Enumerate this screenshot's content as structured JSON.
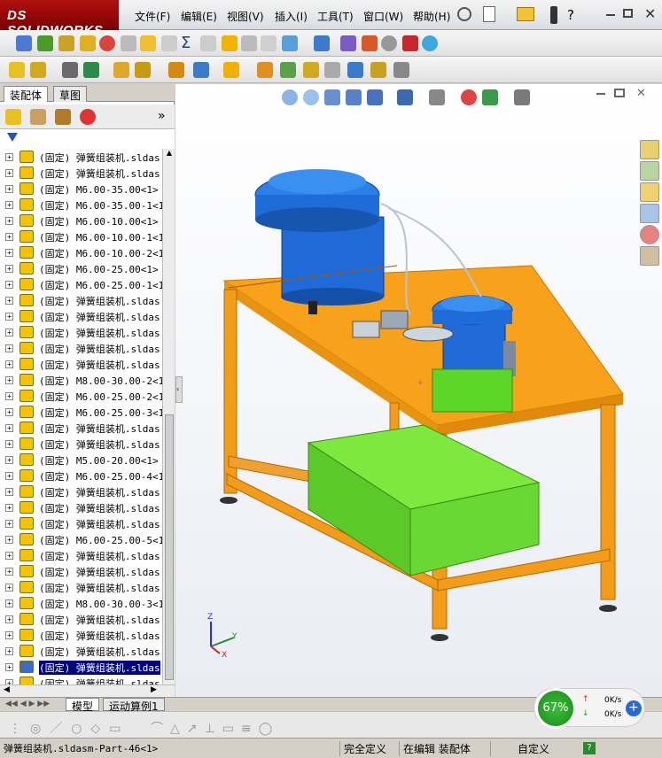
{
  "app": {
    "brand": "SOLIDWORKS",
    "brand_prefix": "DS"
  },
  "menu": [
    "文件(F)",
    "编辑(E)",
    "视图(V)",
    "插入(I)",
    "工具(T)",
    "窗口(W)",
    "帮助(H)"
  ],
  "panel_tabs": [
    "装配体",
    "草图"
  ],
  "tree_items": [
    "(固定) 弹簧组装机.sldas",
    "(固定) 弹簧组装机.sldas",
    "(固定) M6.00-35.00<1> (",
    "(固定) M6.00-35.00-1<1>",
    "(固定) M6.00-10.00<1> (",
    "(固定) M6.00-10.00-1<1>",
    "(固定) M6.00-10.00-2<1>",
    "(固定) M6.00-25.00<1> (",
    "(固定) M6.00-25.00-1<1>",
    "(固定) 弹簧组装机.sldas",
    "(固定) 弹簧组装机.sldas",
    "(固定) 弹簧组装机.sldas",
    "(固定) 弹簧组装机.sldas",
    "(固定) 弹簧组装机.sldas",
    "(固定) M8.00-30.00-2<1>",
    "(固定) M6.00-25.00-2<1>",
    "(固定) M6.00-25.00-3<1>",
    "(固定) 弹簧组装机.sldas",
    "(固定) 弹簧组装机.sldas",
    "(固定) M5.00-20.00<1> (",
    "(固定) M6.00-25.00-4<1>",
    "(固定) 弹簧组装机.sldas",
    "(固定) 弹簧组装机.sldas",
    "(固定) 弹簧组装机.sldas",
    "(固定) M6.00-25.00-5<1>",
    "(固定) 弹簧组装机.sldas",
    "(固定) 弹簧组装机.sldas",
    "(固定) 弹簧组装机.sldas",
    "(固定) M8.00-30.00-3<1>",
    "(固定) 弹簧组装机.sldas",
    "(固定) 弹簧组装机.sldas",
    "(固定) 弹簧组装机.sldas",
    "(固定) 弹簧组装机.sldas",
    "(固定) 弹簧组装机.sldas"
  ],
  "selected_index": 32,
  "bottom_tabs": [
    "模型",
    "运动算例1"
  ],
  "status": {
    "part": "弹簧组装机.sldasm-Part-46<1>",
    "defined": "完全定义",
    "editing": "在编辑 装配体",
    "custom": "自定义"
  },
  "gauge": {
    "percent": "67%",
    "up": "0K/s",
    "down": "0K/s"
  },
  "triad": {
    "x": "X",
    "y": "Y",
    "z": "Z"
  },
  "colors": {
    "frame": "#f5a21b",
    "bowl": "#1e6fd9",
    "bin": "#5cd629"
  }
}
